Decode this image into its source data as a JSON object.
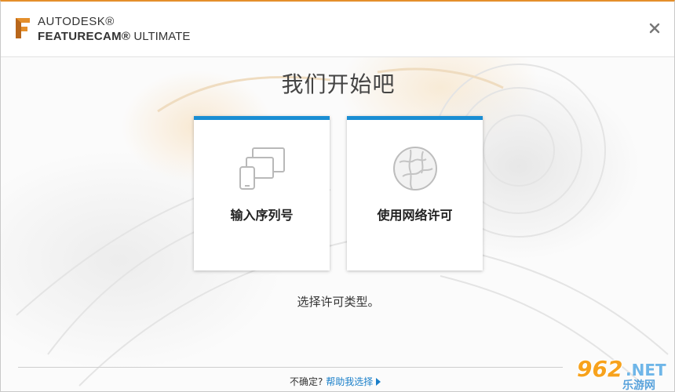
{
  "window": {
    "brand_line1": "AUTODESK®",
    "brand_line2_bold": "FEATURECAM®",
    "brand_line2_rest": " ULTIMATE",
    "accent_color": "#e48f2b",
    "close_icon": "close-icon"
  },
  "main": {
    "heading": "我们开始吧",
    "subtitle": "选择许可类型。",
    "cards": [
      {
        "label": "输入序列号",
        "icon": "devices-icon"
      },
      {
        "label": "使用网络许可",
        "icon": "globe-icon"
      }
    ],
    "card_accent_color": "#1a8ed3"
  },
  "footer": {
    "question": "不确定?",
    "help_link": "帮助我选择",
    "link_color": "#1a7fc9"
  },
  "watermark": {
    "number": "962",
    "net": ".NET",
    "site": "乐游网"
  }
}
